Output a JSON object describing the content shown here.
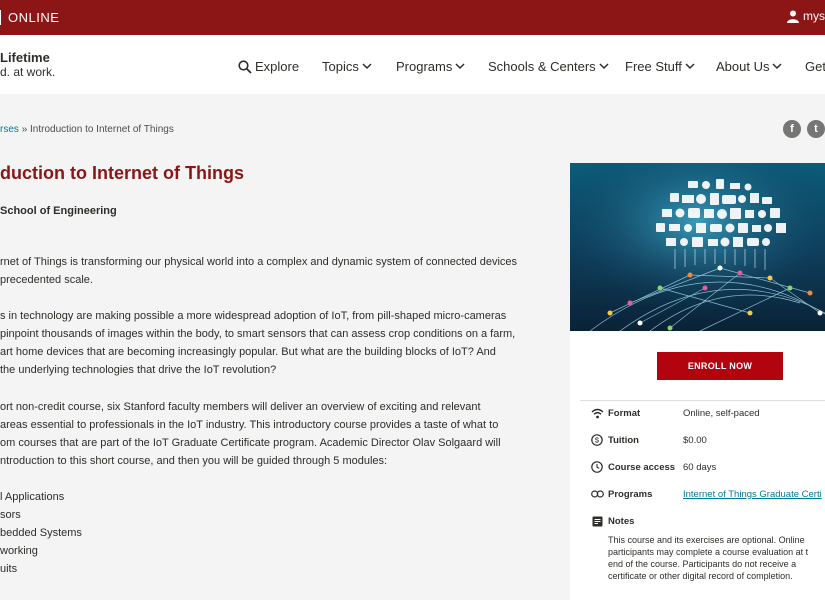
{
  "topbar": {
    "brand": "ONLINE",
    "user_label": "mys"
  },
  "logo": {
    "line1": "Lifetime",
    "line2": "d. at work."
  },
  "nav": {
    "explore": "Explore",
    "topics": "Topics",
    "programs": "Programs",
    "schools": "Schools & Centers",
    "free": "Free Stuff",
    "about": "About Us",
    "get": "Get"
  },
  "breadcrumb": {
    "parent": "rses",
    "separator": "»",
    "current": "Introduction to Internet of Things"
  },
  "social": {
    "facebook": "f",
    "twitter": "t"
  },
  "course": {
    "title": "duction to Internet of Things",
    "school": "School of Engineering",
    "paragraphs": [
      [
        "rnet of Things is transforming our physical world into a complex and dynamic system of connected devices",
        "precedented scale."
      ],
      [
        "s in technology are making possible a more widespread adoption of IoT, from pill-shaped micro-cameras",
        "pinpoint thousands of images within the body, to smart sensors that can assess crop conditions on a farm,",
        "art home devices that are becoming increasingly popular. But what are the building blocks of IoT? And",
        " the underlying technologies that drive the IoT revolution?"
      ],
      [
        "ort non-credit course, six Stanford faculty members will deliver an overview of exciting and relevant",
        " areas essential to professionals in the IoT industry. This introductory course provides a taste of what to",
        "om courses that are part of the IoT Graduate Certificate program. Academic Director Olav Solgaard will",
        "ntroduction to this short course, and then you will be guided through 5 modules:"
      ],
      [
        "l Applications",
        "sors",
        "bedded Systems",
        "working",
        "uits"
      ]
    ]
  },
  "sidebar": {
    "enroll": "ENROLL NOW",
    "format_label": "Format",
    "format_value": "Online, self-paced",
    "tuition_label": "Tuition",
    "tuition_value": "$0.00",
    "access_label": "Course access",
    "access_value": "60 days",
    "programs_label": "Programs",
    "programs_value": "Internet of Things Graduate Certi",
    "notes_label": "Notes",
    "notes_lines": [
      "This course and its exercises are optional. Online",
      "participants may complete a course evaluation at t",
      "end of the course. Participants do not receive a",
      "certificate or other digital record of completion."
    ]
  },
  "colors": {
    "brand_red": "#8c1515",
    "button_red": "#b1040e",
    "link": "#007c92"
  }
}
